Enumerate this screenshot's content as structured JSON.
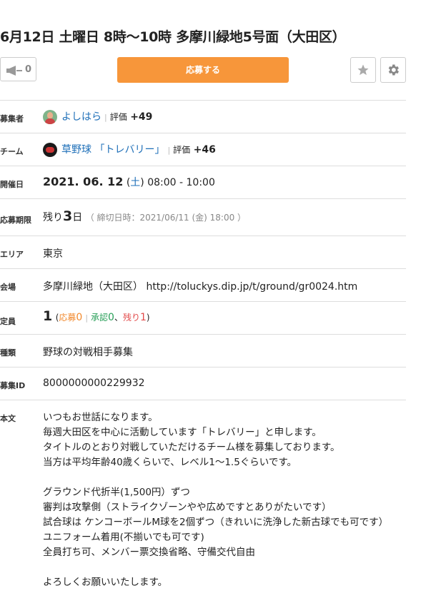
{
  "title": "6月12日 土曜日 8時〜10時 多摩川緑地5号面（大田区）",
  "toolbar": {
    "like_count": "0",
    "apply_label": "応募する",
    "icons": {
      "like": "megaphone-icon",
      "favorite": "star-icon",
      "settings": "gear-icon"
    }
  },
  "details": {
    "organizer": {
      "label": "募集者",
      "name": "よしはら",
      "rating_label": "評価",
      "rating": "+49"
    },
    "team": {
      "label": "チーム",
      "name": "草野球 「トレバリー」",
      "rating_label": "評価",
      "rating": "+46"
    },
    "date": {
      "label": "開催日",
      "date": "2021. 06. 12",
      "weekday": "土",
      "time": "08:00 - 10:00"
    },
    "deadline": {
      "label": "応募期限",
      "prefix": "残り",
      "days": "3",
      "suffix": "日",
      "detail": "（ 締切日時：2021/06/11 (金) 18:00 ）"
    },
    "area": {
      "label": "エリア",
      "value": "東京"
    },
    "venue": {
      "label": "会場",
      "value": "多摩川緑地（大田区） http://toluckys.dip.jp/t/ground/gr0024.htm"
    },
    "capacity": {
      "label": "定員",
      "value": "1",
      "applied_label": "応募",
      "applied": "0",
      "approved_label": "承認",
      "approved": "0",
      "remaining_label": "残り",
      "remaining": "1"
    },
    "category": {
      "label": "種類",
      "value": "野球の対戦相手募集"
    },
    "recruit_id": {
      "label": "募集ID",
      "value": "8000000000229932"
    },
    "body": {
      "label": "本文",
      "text": "いつもお世話になります。\n毎週大田区を中心に活動しています「トレバリー」と申します。\nタイトルのとおり対戦していただけるチーム様を募集しております。\n当方は平均年齢40歳くらいで、レベル1〜1.5ぐらいです。\n\nグラウンド代折半(1,500円）ずつ\n審判は攻撃側（ストライクゾーンやや広めですとありがたいです）\n試合球は ケンコーボールM球を2個ずつ（きれいに洗浄した新古球でも可です）\nユニフォーム着用(不揃いでも可です)\n全員打ち可、メンバー票交換省略、守備交代自由\n\nよろしくお願いいたします。"
    }
  },
  "colors": {
    "accent": "#f7963a",
    "link": "#1e6fb8",
    "applied": "#f28a2e",
    "approved": "#2aa05a",
    "remaining": "#e24a4a"
  }
}
